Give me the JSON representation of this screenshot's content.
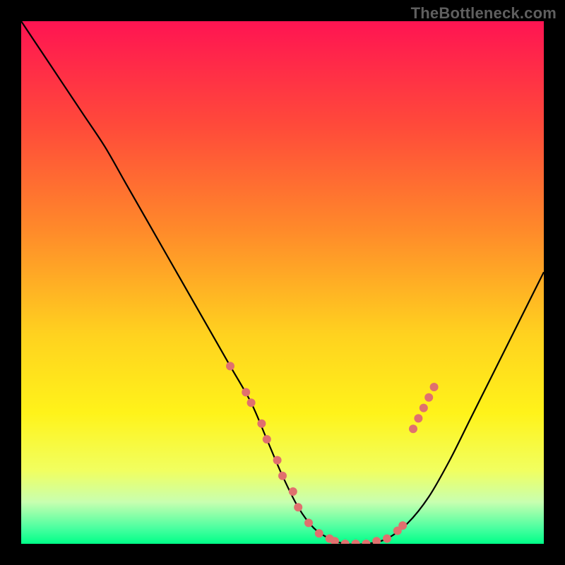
{
  "watermark": {
    "text": "TheBottleneck.com"
  },
  "chart_data": {
    "type": "line",
    "title": "",
    "xlabel": "",
    "ylabel": "",
    "xlim": [
      0,
      100
    ],
    "ylim": [
      0,
      100
    ],
    "background": {
      "type": "vertical-gradient",
      "stops": [
        {
          "pos": 0.0,
          "color": "#ff1452"
        },
        {
          "pos": 0.2,
          "color": "#ff4a3a"
        },
        {
          "pos": 0.4,
          "color": "#ff8a2a"
        },
        {
          "pos": 0.6,
          "color": "#ffd21f"
        },
        {
          "pos": 0.75,
          "color": "#fff31a"
        },
        {
          "pos": 0.86,
          "color": "#f1ff60"
        },
        {
          "pos": 0.92,
          "color": "#c8ffb0"
        },
        {
          "pos": 0.97,
          "color": "#4affa0"
        },
        {
          "pos": 1.0,
          "color": "#00ff88"
        }
      ]
    },
    "frame_color": "#000000",
    "frame_thickness_ratio": 0.037,
    "series": [
      {
        "name": "bottleneck-curve",
        "color": "#000000",
        "width": 2.2,
        "x": [
          0,
          4,
          8,
          12,
          16,
          20,
          24,
          28,
          32,
          36,
          40,
          44,
          47,
          50,
          53,
          56,
          59,
          62,
          66,
          70,
          74,
          78,
          82,
          86,
          90,
          94,
          98,
          100
        ],
        "y": [
          100,
          94,
          88,
          82,
          76,
          69,
          62,
          55,
          48,
          41,
          34,
          27,
          20,
          13,
          7,
          3,
          1,
          0,
          0,
          1,
          4,
          9,
          16,
          24,
          32,
          40,
          48,
          52
        ]
      }
    ],
    "markers": {
      "name": "curve-dots",
      "color": "#e0706e",
      "radius": 6,
      "points": [
        {
          "x": 40,
          "y": 34
        },
        {
          "x": 43,
          "y": 29
        },
        {
          "x": 44,
          "y": 27
        },
        {
          "x": 46,
          "y": 23
        },
        {
          "x": 47,
          "y": 20
        },
        {
          "x": 49,
          "y": 16
        },
        {
          "x": 50,
          "y": 13
        },
        {
          "x": 52,
          "y": 10
        },
        {
          "x": 53,
          "y": 7
        },
        {
          "x": 55,
          "y": 4
        },
        {
          "x": 57,
          "y": 2
        },
        {
          "x": 59,
          "y": 1
        },
        {
          "x": 60,
          "y": 0.5
        },
        {
          "x": 62,
          "y": 0
        },
        {
          "x": 64,
          "y": 0
        },
        {
          "x": 66,
          "y": 0
        },
        {
          "x": 68,
          "y": 0.5
        },
        {
          "x": 70,
          "y": 1
        },
        {
          "x": 72,
          "y": 2.5
        },
        {
          "x": 73,
          "y": 3.5
        },
        {
          "x": 75,
          "y": 22
        },
        {
          "x": 76,
          "y": 24
        },
        {
          "x": 77,
          "y": 26
        },
        {
          "x": 78,
          "y": 28
        },
        {
          "x": 79,
          "y": 30
        }
      ]
    }
  }
}
